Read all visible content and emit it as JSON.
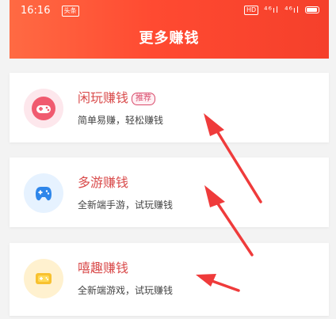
{
  "status_bar": {
    "time": "16:16",
    "notification_badge": "头条",
    "hd_label": "HD",
    "signal_1": "⁴⁶ıl",
    "signal_2": "⁴⁶ıl"
  },
  "header": {
    "title": "更多赚钱"
  },
  "items": [
    {
      "title": "闲玩赚钱",
      "tag": "推荐",
      "subtitle": "简单易赚，轻松赚钱",
      "icon": "gamepad-icon"
    },
    {
      "title": "多游赚钱",
      "subtitle": "全新端手游，试玩赚钱",
      "icon": "gamepad-icon"
    },
    {
      "title": "嘻趣赚钱",
      "subtitle": "全新端游戏，试玩赚钱",
      "icon": "gamepad-icon"
    }
  ],
  "colors": {
    "header_gradient_start": "#ff6a43",
    "header_gradient_end": "#f5402b",
    "title_red": "#d94b4b",
    "arrow_red": "#ef3b3b",
    "tag_pink": "#d94b6b"
  }
}
